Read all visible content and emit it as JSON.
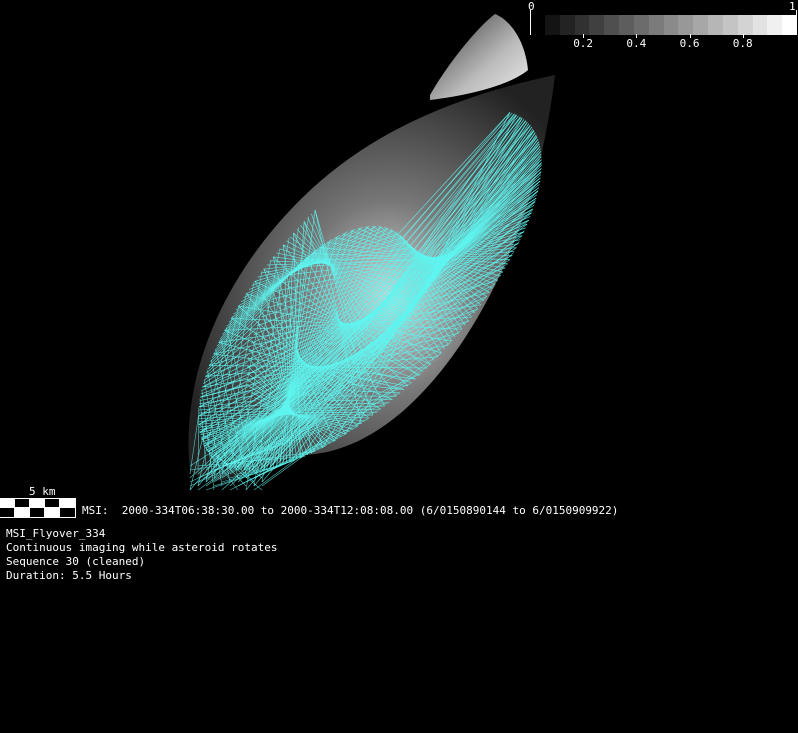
{
  "colorbar": {
    "min_label": "0",
    "max_label": "1",
    "tick_labels": [
      "0.2",
      "0.4",
      "0.6",
      "0.8"
    ],
    "steps": 17
  },
  "scale_bar": {
    "label": "5 km"
  },
  "msi_line": "MSI:  2000-334T06:38:30.00 to 2000-334T12:08:08.00 (6/0150890144 to 6/0150909922)",
  "info": {
    "title": "MSI_Flyover_334",
    "description": "Continuous imaging while asteroid rotates",
    "sequence": "Sequence 30 (cleaned)",
    "duration": "Duration: 5.5 Hours"
  },
  "colors": {
    "footprint": "#5ff5f0",
    "background": "#000000"
  }
}
